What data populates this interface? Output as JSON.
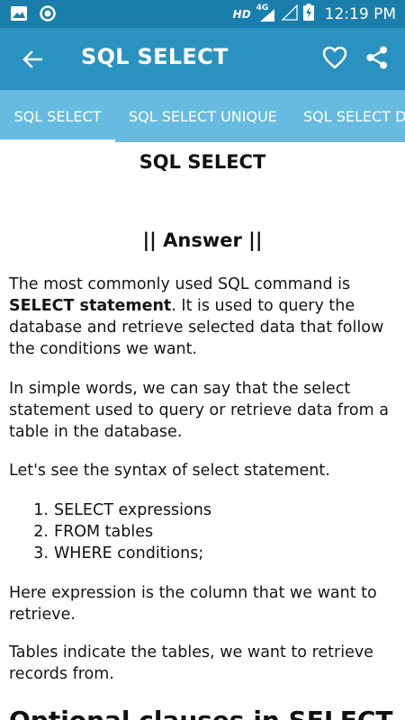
{
  "status_bar": {
    "time": "12:19 PM",
    "network_hd": "HD",
    "network_type": "4G",
    "icons": [
      "image-icon",
      "circle-status-icon",
      "signal-icon",
      "signal-empty-icon",
      "battery-charging-icon"
    ]
  },
  "app_bar": {
    "title": "SQL SELECT",
    "back_icon": "arrow-back-icon",
    "favorite_icon": "heart-outline-icon",
    "share_icon": "share-icon"
  },
  "tabs": [
    {
      "label": "SQL SELECT",
      "active": true
    },
    {
      "label": "SQL SELECT UNIQUE",
      "active": false
    },
    {
      "label": "SQL SELECT D",
      "active": false
    }
  ],
  "content": {
    "heading": "SQL SELECT",
    "answer_heading": "|| Answer ||",
    "p1_before": "The most commonly used SQL command is ",
    "p1_bold": "SELECT statement",
    "p1_after": ". It is used to query the database and retrieve selected data that follow the conditions we want.",
    "p2": "In simple words, we can say that the select statement used to query or retrieve data from a table in the database.",
    "p3": "Let's see the syntax of select statement.",
    "list": [
      {
        "num": "1.",
        "text": "SELECT expressions"
      },
      {
        "num": "2.",
        "text": "FROM tables"
      },
      {
        "num": "3.",
        "text": "WHERE conditions;"
      }
    ],
    "p4": "Here expression is the column that we want to retrieve.",
    "p5": "Tables indicate the tables, we want to retrieve records from.",
    "section_heading": "Optional clauses in SELECT"
  },
  "colors": {
    "status_bar": "#1a7ead",
    "app_bar": "#2a92c0",
    "tab_bar": "#67bbe1",
    "indicator": "#ffffff"
  }
}
